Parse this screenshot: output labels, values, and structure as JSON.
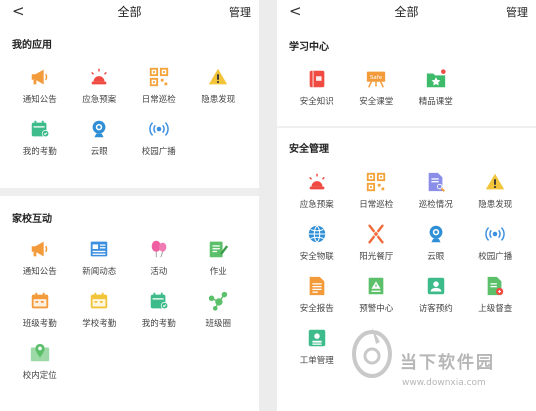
{
  "left": {
    "back_glyph": "<",
    "title": "全部",
    "manage": "管理",
    "sections": [
      {
        "title": "我的应用",
        "items": [
          {
            "label": "通知公告",
            "icon": "megaphone-icon",
            "color": "#f39a3a"
          },
          {
            "label": "应急预案",
            "icon": "alarm-light-icon",
            "color": "#ef4b43"
          },
          {
            "label": "日常巡检",
            "icon": "qr-code-icon",
            "color": "#f4a23a"
          },
          {
            "label": "隐患发现",
            "icon": "warning-icon",
            "color": "#f2c43a"
          },
          {
            "label": "我的考勤",
            "icon": "calendar-check-icon",
            "color": "#3dbb8a"
          },
          {
            "label": "云眼",
            "icon": "webcam-icon",
            "color": "#2f8fd6"
          },
          {
            "label": "校园广播",
            "icon": "broadcast-icon",
            "color": "#3b8fe0"
          }
        ]
      },
      {
        "title": "家校互动",
        "items": [
          {
            "label": "通知公告",
            "icon": "megaphone-icon",
            "color": "#f39a3a"
          },
          {
            "label": "新闻动态",
            "icon": "newspaper-icon",
            "color": "#3b8fe0"
          },
          {
            "label": "活动",
            "icon": "balloons-icon",
            "color": "#ef5ea0"
          },
          {
            "label": "作业",
            "icon": "notebook-pen-icon",
            "color": "#5cc06a"
          },
          {
            "label": "班级考勤",
            "icon": "calendar-icon",
            "color": "#f39a3a"
          },
          {
            "label": "学校考勤",
            "icon": "calendar-icon",
            "color": "#f2c43a"
          },
          {
            "label": "我的考勤",
            "icon": "calendar-check-icon",
            "color": "#3dbb8a"
          },
          {
            "label": "班级圈",
            "icon": "share-nodes-icon",
            "color": "#5cc06a"
          },
          {
            "label": "校内定位",
            "icon": "map-pin-icon",
            "color": "#5cc06a"
          }
        ]
      }
    ]
  },
  "right": {
    "back_glyph": "<",
    "title": "全部",
    "manage": "管理",
    "sections": [
      {
        "title": "学习中心",
        "items": [
          {
            "label": "安全知识",
            "icon": "book-icon",
            "color": "#ef4b43"
          },
          {
            "label": "安全课堂",
            "icon": "safe-board-icon",
            "color": "#f39a3a"
          },
          {
            "label": "精品课堂",
            "icon": "star-folder-icon",
            "color": "#3dbb6a"
          }
        ]
      },
      {
        "title": "安全管理",
        "items": [
          {
            "label": "应急预案",
            "icon": "alarm-light-icon",
            "color": "#ef4b43"
          },
          {
            "label": "日常巡检",
            "icon": "qr-code-icon",
            "color": "#f4a23a"
          },
          {
            "label": "巡检情况",
            "icon": "document-search-icon",
            "color": "#8a8ee8"
          },
          {
            "label": "隐患发现",
            "icon": "warning-icon",
            "color": "#f2c43a"
          },
          {
            "label": "安全物联",
            "icon": "globe-icon",
            "color": "#2f8fd6"
          },
          {
            "label": "阳光餐厅",
            "icon": "utensils-icon",
            "color": "#ef6a3a"
          },
          {
            "label": "云眼",
            "icon": "webcam-icon",
            "color": "#2f8fd6"
          },
          {
            "label": "校园广播",
            "icon": "broadcast-icon",
            "color": "#3b8fe0"
          },
          {
            "label": "安全报告",
            "icon": "report-icon",
            "color": "#f39a3a"
          },
          {
            "label": "预警中心",
            "icon": "warning-doc-icon",
            "color": "#5cc06a"
          },
          {
            "label": "访客预约",
            "icon": "id-card-icon",
            "color": "#3dbb8a"
          },
          {
            "label": "上级督查",
            "icon": "inspect-doc-icon",
            "color": "#5cc06a"
          },
          {
            "label": "工单管理",
            "icon": "badge-icon",
            "color": "#3dbb8a"
          }
        ]
      }
    ]
  },
  "watermark": {
    "name": "当下软件园",
    "url": "www.downxia.com"
  }
}
